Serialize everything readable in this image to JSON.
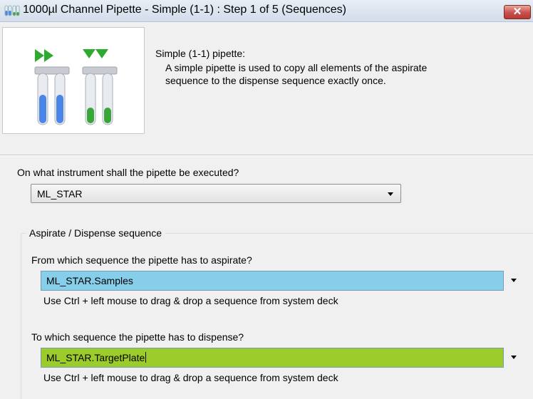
{
  "window": {
    "title": "1000µl Channel Pipette - Simple (1-1) : Step 1 of 5 (Sequences)",
    "close_label": "✕"
  },
  "header": {
    "heading": "Simple (1-1) pipette:",
    "description": "A simple pipette is used to copy all elements of the aspirate sequence to the dispense sequence exactly once.",
    "illustration_colors": {
      "aspirate": "#4a86e8",
      "dispense": "#3aa63a",
      "arrows": "#2eaa2e"
    }
  },
  "instrument": {
    "question": "On what instrument shall the pipette be executed?",
    "selected": "ML_STAR"
  },
  "sequence_group": {
    "label": "Aspirate / Dispense sequence",
    "aspirate": {
      "question": "From which sequence the pipette has to aspirate?",
      "value": "ML_STAR.Samples",
      "hint": "Use Ctrl + left mouse to drag & drop a sequence from system deck",
      "color": "#87ceeb"
    },
    "dispense": {
      "question": "To which sequence the pipette has to dispense?",
      "value": "ML_STAR.TargetPlate",
      "hint": "Use Ctrl + left mouse to drag & drop a sequence from system deck",
      "color": "#9ccc2c"
    }
  }
}
